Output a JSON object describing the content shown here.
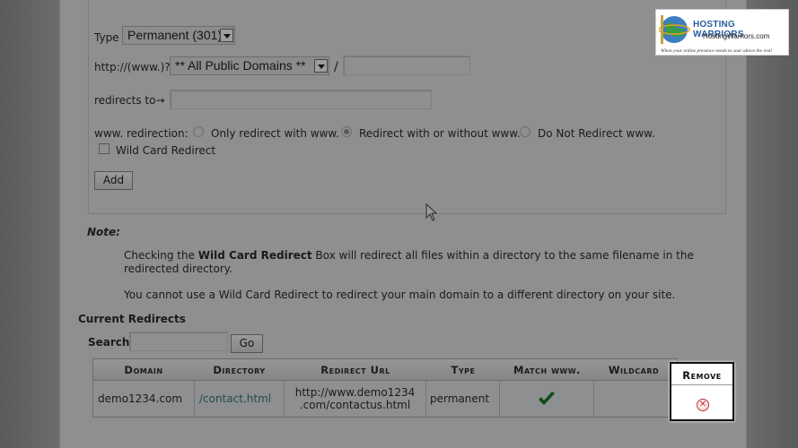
{
  "form": {
    "type_label": "Type",
    "type_value": "Permanent (301)",
    "http_label": "http://(www.)?",
    "domain_value": "** All Public Domains **",
    "slash": "/",
    "path_value": "",
    "redirects_label": "redirects to→",
    "redirects_value": "",
    "www_label": "www. redirection:",
    "radio_options": [
      "Only redirect with www.",
      "Redirect with or without www.",
      "Do Not Redirect www."
    ],
    "radio_selected": 1,
    "wildcard_label": "Wild Card Redirect",
    "wildcard_checked": false,
    "add_label": "Add"
  },
  "note": {
    "heading": "Note:",
    "p1_pre": "Checking the ",
    "p1_bold": "Wild Card Redirect",
    "p1_post": " Box will redirect all files within a directory to the same filename in the redirected directory.",
    "p2": "You cannot use a Wild Card Redirect to redirect your main domain to a different directory on your site."
  },
  "redirects": {
    "heading": "Current Redirects",
    "search_label": "Search",
    "search_value": "",
    "go_label": "Go",
    "columns": [
      "Domain",
      "Directory",
      "Redirect Url",
      "Type",
      "Match www.",
      "Wildcard",
      "Remove"
    ],
    "rows": [
      {
        "domain": "demo1234.com",
        "directory": "/contact.html",
        "redirect_url_line1": "http://www.demo1234",
        "redirect_url_line2": ".com/contactus.html",
        "type": "permanent",
        "match_www": "check-icon",
        "wildcard": "",
        "remove": "remove-icon"
      }
    ]
  },
  "logo": {
    "title": "HOSTING WARRIORS",
    "url": "HostingWarriors.com",
    "tagline": "When your online presence needs to soar above the rest!"
  },
  "colors": {
    "page_bg": "#8e8f90",
    "link": "#1f4d4d",
    "check": "#0d4d1a",
    "remove_highlight": "#ffffff"
  }
}
